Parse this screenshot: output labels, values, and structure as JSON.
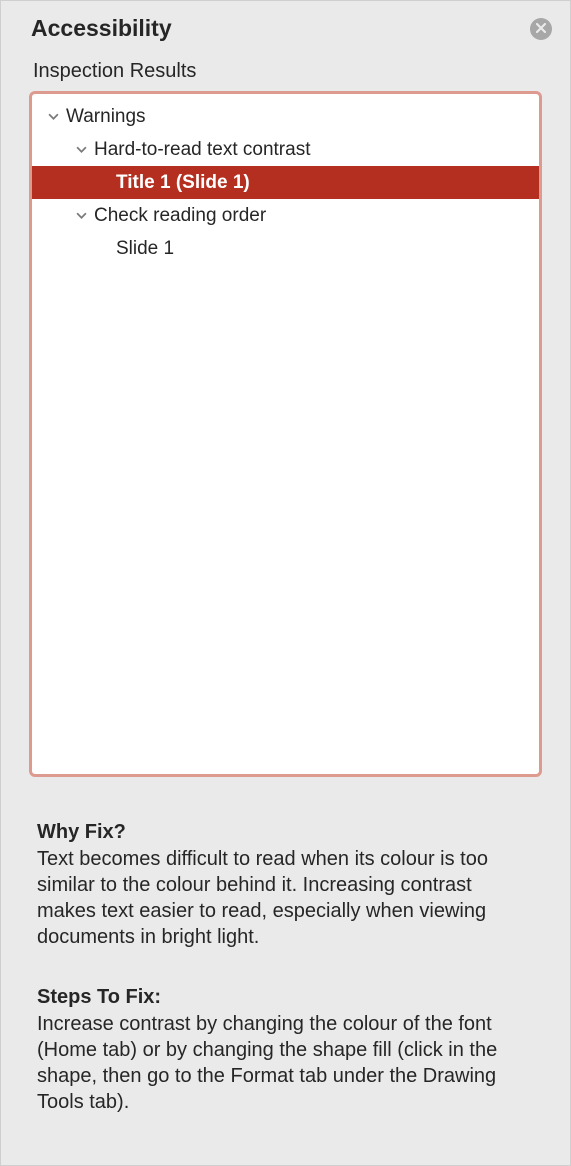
{
  "panel": {
    "title": "Accessibility",
    "section_label": "Inspection Results"
  },
  "tree": {
    "warnings_label": "Warnings",
    "contrast_label": "Hard-to-read text contrast",
    "contrast_item": "Title 1  (Slide 1)",
    "reading_order_label": "Check reading order",
    "reading_order_item": "Slide 1"
  },
  "details": {
    "why_heading": "Why Fix?",
    "why_body": "Text becomes difficult to read when its colour is too similar to the colour behind it. Increasing contrast makes text easier to read, especially when viewing documents in bright light.",
    "steps_heading": "Steps To Fix:",
    "steps_body": "Increase contrast by changing the colour of the font (Home tab) or by changing the shape fill (click in the shape, then go to the Format tab under the Drawing Tools tab)."
  }
}
